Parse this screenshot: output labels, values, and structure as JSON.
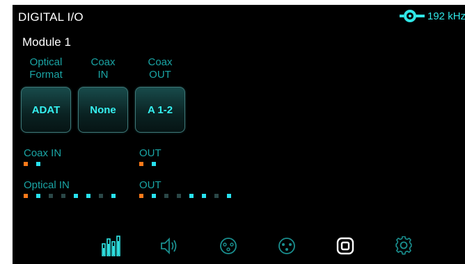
{
  "header": {
    "title": "DIGITAL I/O",
    "sample_rate": "192 kHz"
  },
  "module": {
    "name": "Module 1"
  },
  "columns": [
    {
      "line1": "Optical",
      "line2": "Format",
      "value": "ADAT"
    },
    {
      "line1": "Coax",
      "line2": "IN",
      "value": "None"
    },
    {
      "line1": "Coax",
      "line2": "OUT",
      "value": "A 1-2"
    }
  ],
  "signals": {
    "coax_in": {
      "label": "Coax IN",
      "leds": [
        "orange",
        "on"
      ]
    },
    "coax_out": {
      "label": "OUT",
      "leds": [
        "orange",
        "on"
      ]
    },
    "optical_in": {
      "label": "Optical IN",
      "leds": [
        "orange",
        "on",
        "off",
        "off",
        "on",
        "on",
        "off",
        "on"
      ]
    },
    "optical_out": {
      "label": "OUT",
      "leds": [
        "orange",
        "on",
        "off",
        "off",
        "on",
        "on",
        "off",
        "on"
      ]
    }
  },
  "nav": [
    {
      "icon": "meters-icon",
      "active": true
    },
    {
      "icon": "speaker-icon",
      "active": false
    },
    {
      "icon": "xlr-input-icon",
      "active": false
    },
    {
      "icon": "xlr-output-icon",
      "active": false
    },
    {
      "icon": "digital-io-icon",
      "active": true
    },
    {
      "icon": "gear-icon",
      "active": false
    }
  ],
  "colors": {
    "accent": "#30e6e6",
    "label": "#1aa5a5",
    "led_orange": "#ff7a1a",
    "led_on": "#28e2ef",
    "led_off": "#2a4747",
    "background": "#000000"
  }
}
